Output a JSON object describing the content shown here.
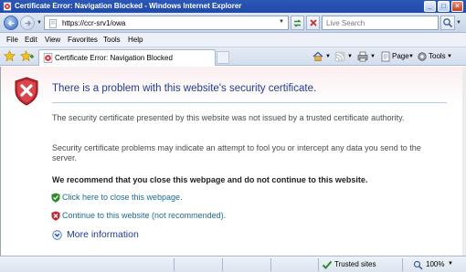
{
  "window": {
    "title": "Certificate Error: Navigation Blocked - Windows Internet Explorer",
    "minimize_glyph": "_",
    "maximize_glyph": "□",
    "close_glyph": "×"
  },
  "address_bar": {
    "url": "https://ccr-srv1/owa",
    "search_placeholder": "Live Search"
  },
  "menu": [
    "File",
    "Edit",
    "View",
    "Favorites",
    "Tools",
    "Help"
  ],
  "tab": {
    "label": "Certificate Error: Navigation Blocked"
  },
  "command_bar": {
    "page_label": "Page",
    "tools_label": "Tools"
  },
  "content": {
    "headline": "There is a problem with this website's security certificate.",
    "paragraph1": "The security certificate presented by this website was not issued by a trusted certificate authority.",
    "paragraph2": "Security certificate problems may indicate an attempt to fool you or intercept any data you send to the server.",
    "recommendation": "We recommend that you close this webpage and do not continue to this website.",
    "close_link": "Click here to close this webpage.",
    "continue_link": "Continue to this website (not recommended).",
    "more_info": "More information"
  },
  "status_bar": {
    "zone": "Trusted sites",
    "zoom": "100%"
  },
  "colors": {
    "headline": "#1d3e8f",
    "link": "#1d6b8f",
    "shield_red": "#c3262e",
    "shield_green": "#2e8b2e",
    "titlebar": "#2c58b8"
  }
}
